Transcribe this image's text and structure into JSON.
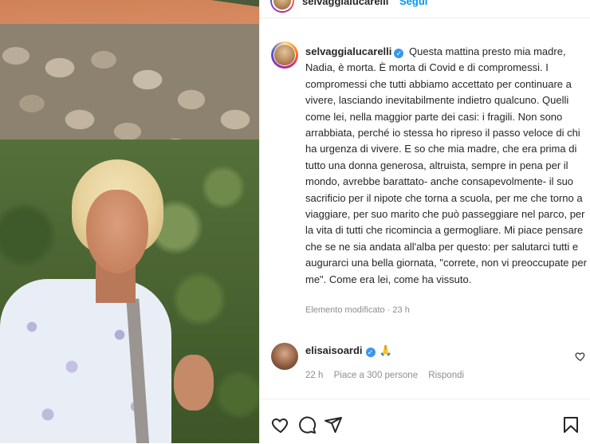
{
  "post": {
    "author": "selvaggialucarelli",
    "follow_label": "Segui",
    "caption": "Questa mattina presto mia madre, Nadia, è morta. È morta di Covid e di compromessi. I compromessi che tutti abbiamo accettato per continuare a vivere, lasciando inevitabilmente indietro qualcuno. Quelli come lei, nella maggior parte dei casi: i fragili. Non sono arrabbiata, perché io stessa ho ripreso il passo veloce di chi ha urgenza di vivere. E so che mia madre, che era prima di tutto una donna generosa, altruista, sempre in pena per il mondo, avrebbe barattato- anche consapevolmente- il suo sacrificio per il nipote che torna a scuola, per me che torno a viaggiare, per suo marito che può passeggiare nel parco, per la vita di tutti che ricomincia a germogliare. Mi piace pensare che se ne sia andata all'alba per questo: per salutarci tutti e augurarci una bella giornata, \"correte, non vi preoccupate per me\". Come era lei, come ha vissuto.",
    "meta": "Elemento modificato · 23 h",
    "verified_mark": "✓"
  },
  "comment": {
    "author": "elisaisoardi",
    "emoji": "🙏",
    "time": "22 h",
    "likes": "Piace a 300 persone",
    "reply_label": "Rispondi"
  },
  "icons": {
    "like": "heart-icon",
    "comment": "comment-icon",
    "share": "paper-plane-icon",
    "save": "bookmark-icon",
    "comment_like": "heart-small-icon"
  },
  "colors": {
    "link_blue": "#0095f6",
    "verified_blue": "#3897f0",
    "text": "#262626",
    "muted": "#8e8e8e"
  }
}
